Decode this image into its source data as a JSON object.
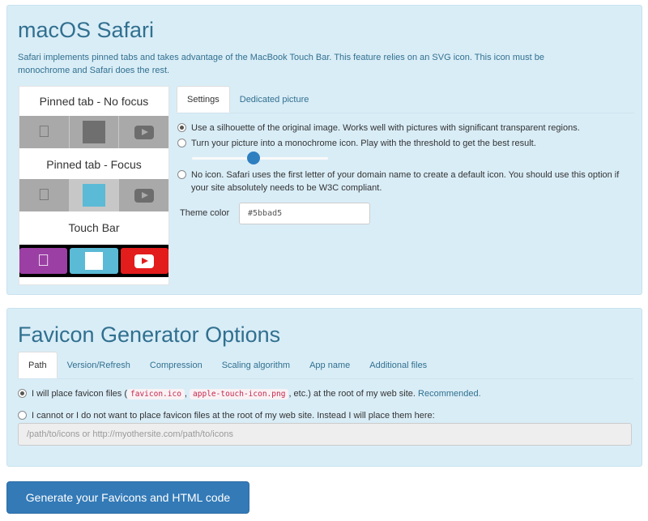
{
  "safari": {
    "title": "macOS Safari",
    "description": "Safari implements pinned tabs and takes advantage of the MacBook Touch Bar. This feature relies on an SVG icon. This icon must be monochrome and Safari does the rest.",
    "preview": {
      "no_focus_label": "Pinned tab - No focus",
      "focus_label": "Pinned tab - Focus",
      "touch_bar_label": "Touch Bar"
    },
    "tabs": [
      {
        "label": "Settings",
        "active": true
      },
      {
        "label": "Dedicated picture",
        "active": false
      }
    ],
    "options": {
      "silhouette": "Use a silhouette of the original image. Works well with pictures with significant transparent regions.",
      "monochrome": "Turn your picture into a monochrome icon. Play with the threshold to get the best result.",
      "no_icon": "No icon. Safari uses the first letter of your domain name to create a default icon. You should use this option if your site absolutely needs to be W3C compliant."
    },
    "selected_option": "silhouette",
    "threshold_fraction": 0.45,
    "theme_color_label": "Theme color",
    "theme_color_value": "#5bbad5"
  },
  "options": {
    "title": "Favicon Generator Options",
    "tabs": [
      {
        "label": "Path",
        "active": true
      },
      {
        "label": "Version/Refresh",
        "active": false
      },
      {
        "label": "Compression",
        "active": false
      },
      {
        "label": "Scaling algorithm",
        "active": false
      },
      {
        "label": "App name",
        "active": false
      },
      {
        "label": "Additional files",
        "active": false
      }
    ],
    "path_root": {
      "prefix": "I will place favicon files (",
      "file1": "favicon.ico",
      "sep": ",",
      "file2": "apple-touch-icon.png",
      "suffix": ", etc.) at the root of my web site.",
      "recommended": "Recommended."
    },
    "path_custom": "I cannot or I do not want to place favicon files at the root of my web site. Instead I will place them here:",
    "path_placeholder": "/path/to/icons or http://myothersite.com/path/to/icons"
  },
  "generate_button": "Generate your Favicons and HTML code",
  "colors": {
    "panel_bg": "#d9edf7",
    "panel_text": "#31708f",
    "primary_button": "#337ab7",
    "theme": "#5bbad5",
    "touchbar_purple": "#9b3fa5",
    "touchbar_red": "#e31c1c"
  },
  "icons": [
    "apple-icon",
    "square-icon",
    "youtube-icon"
  ]
}
